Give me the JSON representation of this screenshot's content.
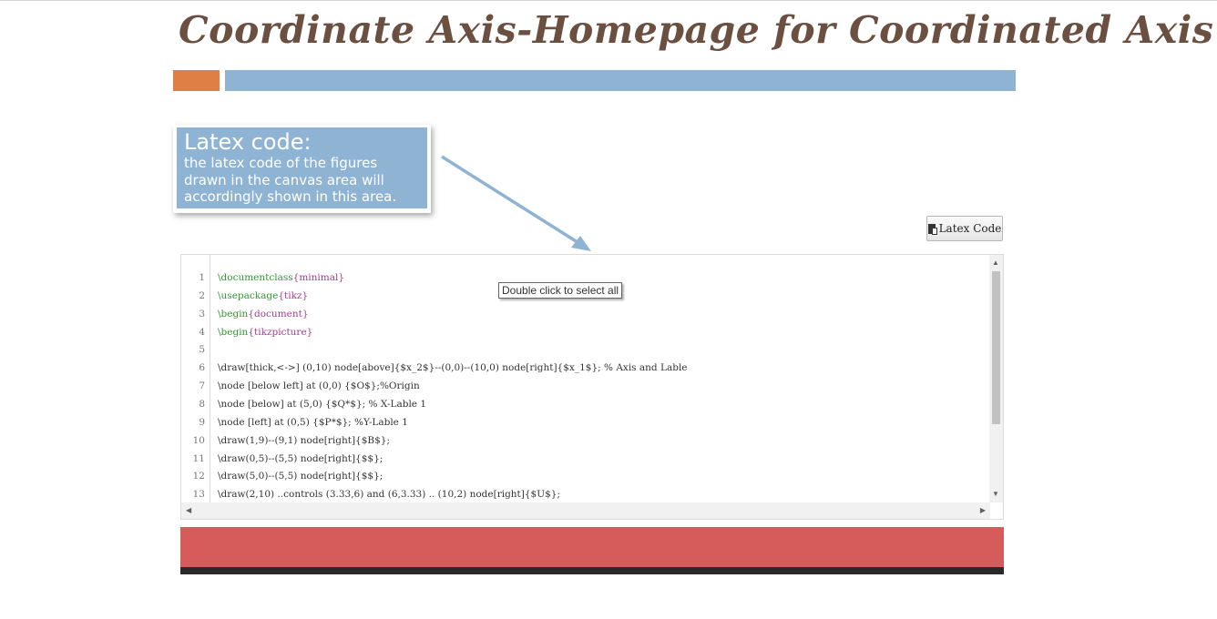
{
  "header": {
    "title": "Coordinate Axis-Homepage for Coordinated Axis"
  },
  "callout": {
    "heading": "Latex code:",
    "lines": [
      "the latex code of the figures",
      "drawn in the canvas area will",
      "accordingly shown in this area."
    ]
  },
  "toolbar": {
    "latex_button_label": "Latex Code",
    "latex_button_icon": "clipboard-icon"
  },
  "editor": {
    "tooltip": "Double click to select all",
    "lines": [
      {
        "num": "1",
        "segments": [
          {
            "t": "\\documentclass",
            "c": "kw"
          },
          {
            "t": "{minimal}",
            "c": "arg"
          }
        ]
      },
      {
        "num": "2",
        "segments": [
          {
            "t": "\\usepackage",
            "c": "kw"
          },
          {
            "t": "{tikz}",
            "c": "arg"
          }
        ]
      },
      {
        "num": "3",
        "segments": [
          {
            "t": "\\begin",
            "c": "kw"
          },
          {
            "t": "{document}",
            "c": "arg"
          }
        ]
      },
      {
        "num": "4",
        "segments": [
          {
            "t": "\\begin",
            "c": "kw"
          },
          {
            "t": "{tikzpicture}",
            "c": "arg"
          }
        ]
      },
      {
        "num": "5",
        "segments": []
      },
      {
        "num": "6",
        "segments": [
          {
            "t": "\\draw[thick,<->] (0,10) node[above]{$x_2$}--(0,0)--(10,0) node[right]{$x_1$}; % Axis and Lable",
            "c": ""
          }
        ]
      },
      {
        "num": "7",
        "segments": [
          {
            "t": "\\node [below left] at (0,0) {$O$};%Origin",
            "c": ""
          }
        ]
      },
      {
        "num": "8",
        "segments": [
          {
            "t": "\\node [below] at (5,0) {$Q*$}; % X-Lable 1",
            "c": ""
          }
        ]
      },
      {
        "num": "9",
        "segments": [
          {
            "t": "\\node [left] at (0,5) {$P*$}; %Y-Lable 1",
            "c": ""
          }
        ]
      },
      {
        "num": "10",
        "segments": [
          {
            "t": "\\draw(1,9)--(9,1) node[right]{$B$};",
            "c": ""
          }
        ]
      },
      {
        "num": "11",
        "segments": [
          {
            "t": "\\draw(0,5)--(5,5) node[right]{$$};",
            "c": ""
          }
        ]
      },
      {
        "num": "12",
        "segments": [
          {
            "t": "\\draw(5,0)--(5,5) node[right]{$$};",
            "c": ""
          }
        ]
      },
      {
        "num": "13",
        "segments": [
          {
            "t": "\\draw(2,10) ..controls (3.33,6) and (6,3.33) .. (10,2) node[right]{$U$};",
            "c": ""
          }
        ]
      }
    ]
  },
  "colors": {
    "title": "#6b5042",
    "accent_orange": "#e07f45",
    "accent_blue": "#8fb3d3",
    "footer_red": "#d55c5a",
    "footer_dark": "#2a2a2a",
    "code_keyword": "#2e9a2e",
    "code_argument": "#a43b8e"
  }
}
